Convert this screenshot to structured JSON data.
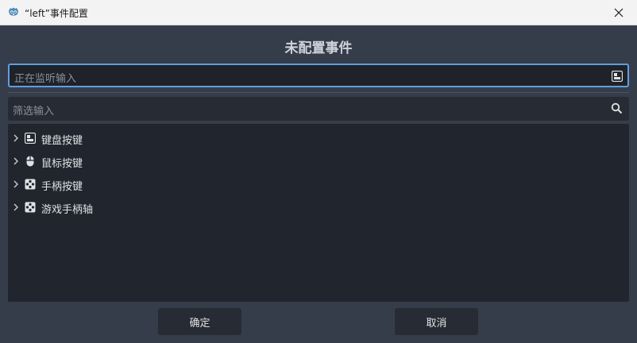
{
  "window": {
    "title": "“left”事件配置"
  },
  "dialog": {
    "heading": "未配置事件",
    "listen_input": {
      "placeholder": "正在监听输入",
      "icon": "keyboard-icon"
    },
    "filter_input": {
      "placeholder": "筛选输入",
      "icon": "search-icon"
    },
    "tree": {
      "items": [
        {
          "label": "键盘按键",
          "icon": "keyboard-icon"
        },
        {
          "label": "鼠标按键",
          "icon": "mouse-icon"
        },
        {
          "label": "手柄按键",
          "icon": "joypad-icon"
        },
        {
          "label": "游戏手柄轴",
          "icon": "joypad-icon"
        }
      ]
    },
    "buttons": {
      "ok": "确定",
      "cancel": "取消"
    }
  },
  "colors": {
    "accent": "#5d9fde",
    "background": "#363d4a",
    "panel": "#21252d",
    "app_icon": "#478cbf"
  }
}
